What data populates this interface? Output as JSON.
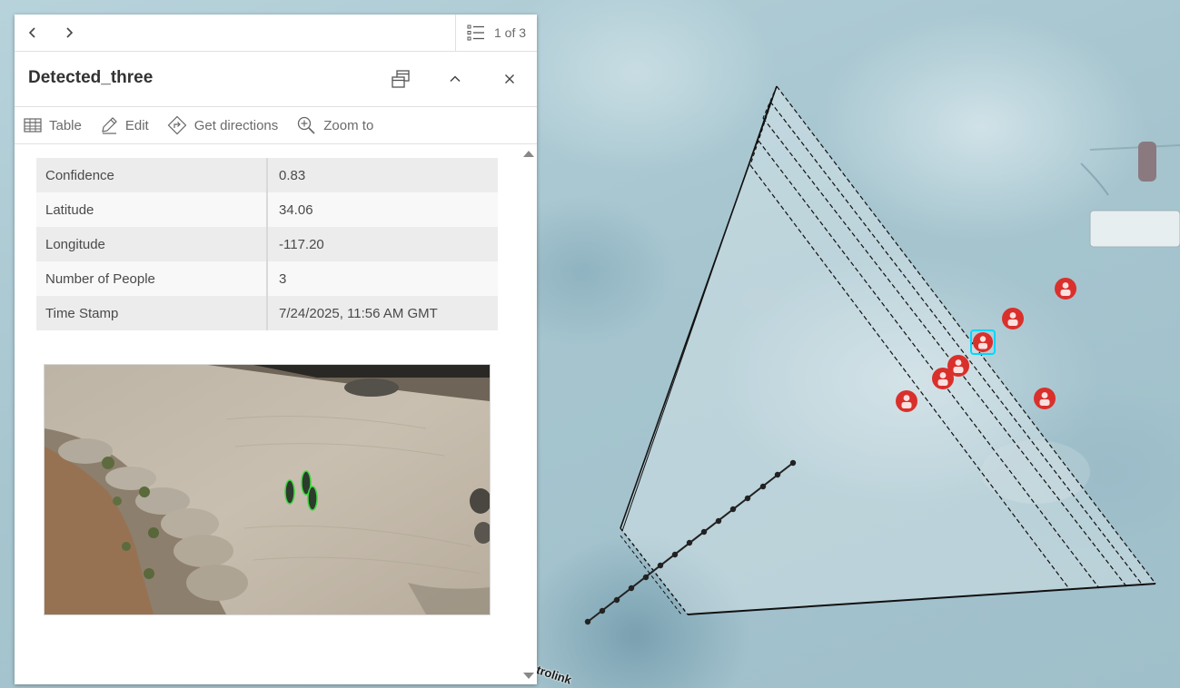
{
  "popup": {
    "nav": {
      "count": "1 of 3"
    },
    "title": "Detected_three",
    "actions": [
      {
        "label": "Table",
        "icon": "table-icon"
      },
      {
        "label": "Edit",
        "icon": "edit-icon"
      },
      {
        "label": "Get directions",
        "icon": "directions-icon"
      },
      {
        "label": "Zoom to",
        "icon": "zoom-to-icon"
      }
    ],
    "attributes": [
      {
        "key": "Confidence",
        "value": "0.83"
      },
      {
        "key": "Latitude",
        "value": "34.06"
      },
      {
        "key": "Longitude",
        "value": "-117.20"
      },
      {
        "key": "Number of People",
        "value": "3"
      },
      {
        "key": "Time Stamp",
        "value": "7/24/2025, 11:56 AM GMT"
      }
    ]
  },
  "map": {
    "road_label": "trolink",
    "marker_color": "#d9302c",
    "selected_color": "#00d8ff"
  }
}
